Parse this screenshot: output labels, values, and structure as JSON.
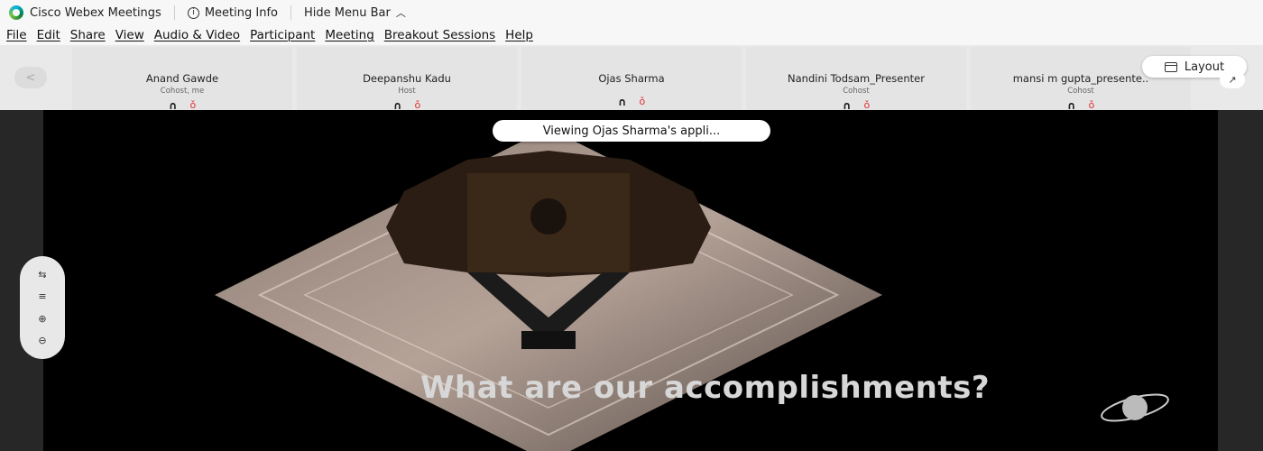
{
  "titlebar": {
    "app_name": "Cisco Webex Meetings",
    "meeting_info": "Meeting Info",
    "hide_menu": "Hide Menu Bar"
  },
  "menu": [
    "File",
    "Edit",
    "Share",
    "View",
    "Audio & Video",
    "Participant",
    "Meeting",
    "Breakout Sessions",
    "Help"
  ],
  "participants": [
    {
      "name": "Anand Gawde",
      "role": "Cohost, me"
    },
    {
      "name": "Deepanshu Kadu",
      "role": "Host"
    },
    {
      "name": "Ojas Sharma",
      "role": ""
    },
    {
      "name": "Nandini Todsam_Presenter",
      "role": "Cohost"
    },
    {
      "name": "mansi m gupta_presente..",
      "role": "Cohost"
    }
  ],
  "layout_label": "Layout",
  "viewing_text": "Viewing Ojas Sharma's appli...",
  "caption": "What are our accomplishments?",
  "icons": {
    "app": "webex-logo-icon",
    "info": "info-circle-icon",
    "chevron": "chevron-up-icon",
    "nav_prev": "chevron-left-icon",
    "headset": "headset-icon",
    "mic_muted": "mic-muted-icon",
    "layout": "layout-icon"
  },
  "colors": {
    "muted_mic": "#e03030",
    "share_bg": "#000000"
  }
}
